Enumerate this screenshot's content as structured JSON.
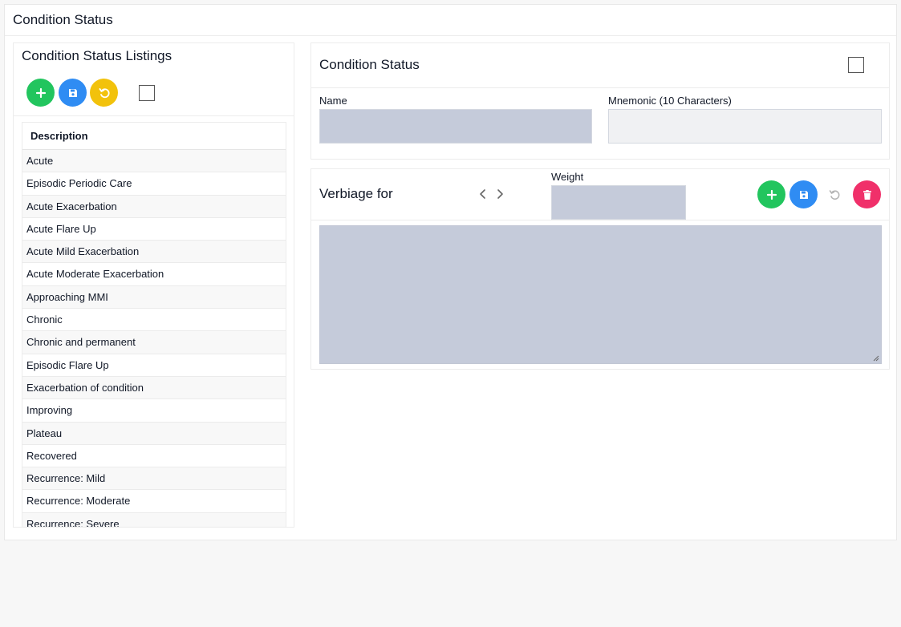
{
  "header": {
    "title": "Condition Status"
  },
  "left": {
    "title": "Condition Status Listings",
    "toolbar": {
      "add_icon": "plus-icon",
      "save_icon": "floppy-disk-icon",
      "reset_icon": "undo-icon"
    },
    "list": {
      "header": "Description",
      "items": [
        "Acute",
        "Episodic Periodic Care",
        "Acute Exacerbation",
        "Acute Flare Up",
        "Acute Mild Exacerbation",
        "Acute Moderate Exacerbation",
        "Approaching MMI",
        "Chronic",
        "Chronic and permanent",
        "Episodic Flare Up",
        "Exacerbation of condition",
        "Improving",
        "Plateau",
        "Recovered",
        "Recurrence: Mild",
        "Recurrence: Moderate",
        "Recurrence: Severe"
      ]
    }
  },
  "detail": {
    "title": "Condition Status",
    "name_label": "Name",
    "name_value": "",
    "mnemonic_label": "Mnemonic (10 Characters)",
    "mnemonic_value": ""
  },
  "verbiage": {
    "title": "Verbiage for",
    "weight_label": "Weight",
    "weight_value": "",
    "text_value": ""
  },
  "colors": {
    "green": "#22c55e",
    "blue": "#2f8cf3",
    "yellow": "#f2c20c",
    "red": "#f0306a",
    "field_fill": "#c5cbda"
  }
}
